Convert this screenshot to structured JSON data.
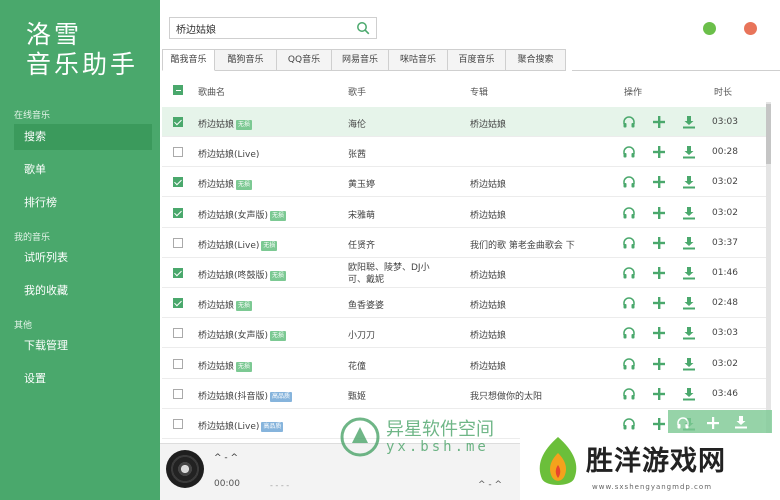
{
  "app": {
    "title": "洛雪 音乐助手",
    "colors": {
      "accent": "#4aa86c",
      "sidebar": "#4aa86c",
      "highlight": "#e6f4ea",
      "min_button": "#6bbf4a",
      "close_button": "#e8745a"
    }
  },
  "sidebar": {
    "groups": [
      {
        "label": "在线音乐",
        "items": [
          {
            "label": "搜索",
            "active": true
          },
          {
            "label": "歌单"
          },
          {
            "label": "排行榜"
          }
        ]
      },
      {
        "label": "我的音乐",
        "items": [
          {
            "label": "试听列表"
          },
          {
            "label": "我的收藏"
          }
        ]
      },
      {
        "label": "其他",
        "items": [
          {
            "label": "下载管理"
          },
          {
            "label": "设置"
          }
        ]
      }
    ]
  },
  "search": {
    "value": "桥边姑娘",
    "icon": "search-icon"
  },
  "tabs": [
    {
      "label": "酷我音乐",
      "active": true
    },
    {
      "label": "酷狗音乐"
    },
    {
      "label": "QQ音乐"
    },
    {
      "label": "网易音乐"
    },
    {
      "label": "咪咕音乐"
    },
    {
      "label": "百度音乐"
    },
    {
      "label": "聚合搜索"
    }
  ],
  "table": {
    "headers": {
      "song": "歌曲名",
      "artist": "歌手",
      "album": "专辑",
      "actions": "操作",
      "duration": "时长"
    },
    "action_icons": [
      "headphones-icon",
      "add-icon",
      "download-icon"
    ],
    "rows": [
      {
        "checked": true,
        "song": "桥边姑娘",
        "badge": "无损",
        "artist": "海伦",
        "album": "桥边姑娘",
        "duration": "03:03",
        "highlight": true
      },
      {
        "checked": false,
        "song": "桥边姑娘(Live)",
        "badge": "",
        "artist": "张茜",
        "album": "",
        "duration": "00:28"
      },
      {
        "checked": true,
        "song": "桥边姑娘",
        "badge": "无损",
        "artist": "黄玉婷",
        "album": "桥边姑娘",
        "duration": "03:02"
      },
      {
        "checked": true,
        "song": "桥边姑娘(女声版)",
        "badge": "无损",
        "artist": "宋雅萌",
        "album": "桥边姑娘",
        "duration": "03:02"
      },
      {
        "checked": false,
        "song": "桥边姑娘(Live)",
        "badge": "无损",
        "artist": "任贤齐",
        "album": "我们的歌 第老金曲歌会 下",
        "duration": "03:37"
      },
      {
        "checked": true,
        "song": "桥边姑娘(咚鼓版)",
        "badge": "无损",
        "artist": "欧阳聪、陵梦、DJ小可、戴妮",
        "album": "桥边姑娘",
        "duration": "01:46",
        "multiline": true
      },
      {
        "checked": true,
        "song": "桥边姑娘",
        "badge": "无损",
        "artist": "鱼香婆婆",
        "album": "桥边姑娘",
        "duration": "02:48"
      },
      {
        "checked": false,
        "song": "桥边姑娘(女声版)",
        "badge": "无损",
        "artist": "小刀刀",
        "album": "桥边姑娘",
        "duration": "03:03"
      },
      {
        "checked": false,
        "song": "桥边姑娘",
        "badge": "无损",
        "artist": "花僮",
        "album": "桥边姑娘",
        "duration": "03:02"
      },
      {
        "checked": false,
        "song": "桥边姑娘(抖音版)",
        "badge": "高品质",
        "badge_color": "blue",
        "artist": "甄姬",
        "album": "我只想做你的太阳",
        "duration": "03:46"
      },
      {
        "checked": false,
        "song": "桥边姑娘(Live)",
        "badge": "高品质",
        "badge_color": "blue",
        "artist": "",
        "album": "",
        "duration": ""
      }
    ]
  },
  "header_checkbox": "partial",
  "player": {
    "title": "^ - ^",
    "time_current": "00:00",
    "time_total": "^ - ^",
    "dash": "- - - -"
  },
  "watermarks": {
    "center_title": "异星软件空间",
    "center_url": "yx.bsh.me",
    "badge_title": "胜洋游戏网",
    "badge_url": "www.sxshengyangmdp.com"
  }
}
